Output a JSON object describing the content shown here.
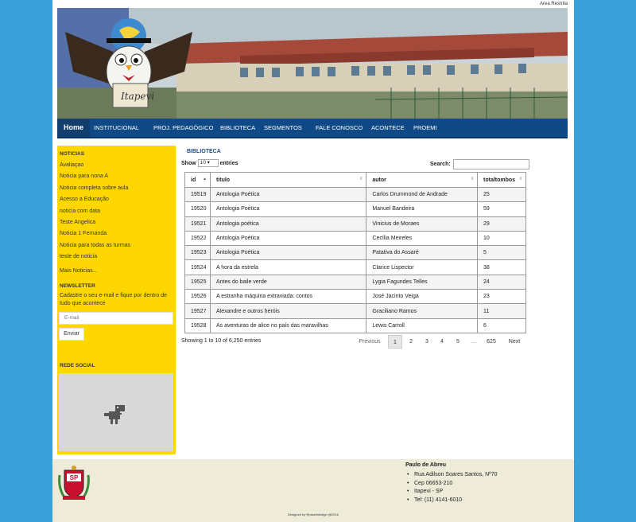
{
  "header": {
    "restricted_link": "Area Restrita",
    "logo_text": "Itapevi"
  },
  "nav": {
    "home": "Home",
    "items": [
      "INSTITUCIONAL",
      "PROJ. PEDAGÓGICO",
      "BIBLIOTECA",
      "SEGMENTOS",
      "FALE CONOSCO",
      "ACONTECE",
      "PROEMI"
    ]
  },
  "sidebar": {
    "news_heading": "NOTICIAS",
    "news": [
      "Avaliaçao",
      "Noticia para nona A",
      "Noticia completa sobre aula",
      "Acesso a Educação",
      "noticia com data",
      "Teste Angelica",
      "Noticia 1 Fernanda",
      "Noticia para todas as turmas",
      "teste de noticia"
    ],
    "more_news": "Mais Noticias...",
    "newsletter_heading": "NEWSLETTER",
    "newsletter_text": "Cadastre o seu e-mail e fique por dentro de tudo que acontece",
    "email_placeholder": "E-mail",
    "send_label": "Enviar",
    "social_heading": "REDE SOCIAL"
  },
  "main": {
    "section_title": "BIBLIOTECA",
    "show_label": "Show",
    "show_value": "10",
    "entries_label": "entries",
    "search_label": "Search:",
    "columns": [
      "id",
      "titulo",
      "autor",
      "totaltombos"
    ],
    "rows": [
      [
        "19519",
        "Antologia Poética",
        "Carlos Drummond de Andrade",
        "25"
      ],
      [
        "19520",
        "Antologia Poética",
        "Manuel Bandeira",
        "59"
      ],
      [
        "19521",
        "Antologia poética",
        "Vinicius de Moraes",
        "29"
      ],
      [
        "19522",
        "Antologia Poética",
        "Cecília Meireles",
        "10"
      ],
      [
        "19523",
        "Antologia Poética",
        "Patativa do Assaré",
        "5"
      ],
      [
        "19524",
        "A hora da estrela",
        "Clarice Lispector",
        "38"
      ],
      [
        "19525",
        "Antes do baile verde",
        "Lygia Fagundes Telles",
        "24"
      ],
      [
        "19526",
        "A estranha máquina extraviada: contos",
        "José Jacinto Veiga",
        "23"
      ],
      [
        "19527",
        "Alexandre e outros heróis",
        "Graciliano Ramos",
        "11"
      ],
      [
        "19528",
        "As aventuras de alice no país das maravilhas",
        "Lewis Carroll",
        "6"
      ]
    ],
    "info": "Showing 1 to 10 of 6,250 entries",
    "pagination": {
      "previous": "Previous",
      "pages": [
        "1",
        "2",
        "3",
        "4",
        "5"
      ],
      "ellipsis": "…",
      "last": "625",
      "next": "Next"
    }
  },
  "footer": {
    "name": "Paulo de Abreu",
    "address_lines": [
      "Rua Adilson Soares Santos, Nº70",
      "Cep 06653-210",
      "Itapevi - SP",
      "Tel: (11) 4141-6010"
    ],
    "credit": "Designed by Rpswebdesign @2016",
    "seal_text": "SP"
  },
  "colors": {
    "background": "#3aa0d8",
    "nav": "#0f4a86",
    "sidebar": "#ffd700",
    "footer": "#eeebd8"
  }
}
